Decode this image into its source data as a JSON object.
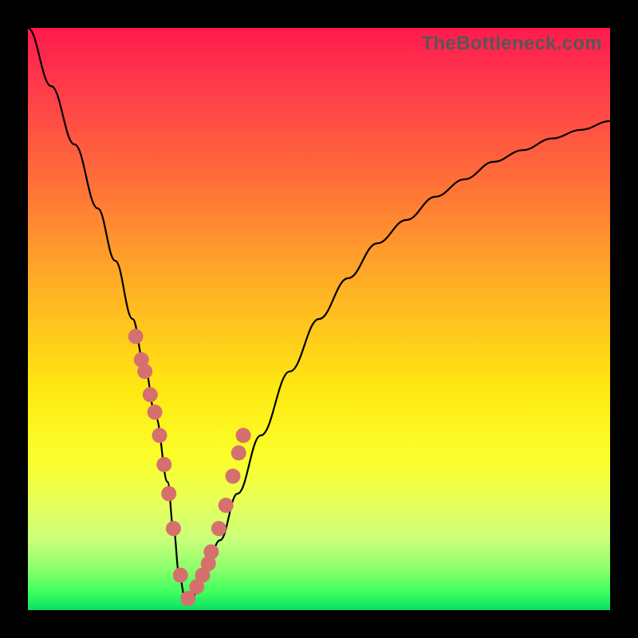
{
  "watermark": "TheBottleneck.com",
  "chart_data": {
    "type": "line",
    "title": "",
    "xlabel": "",
    "ylabel": "",
    "xlim": [
      0,
      100
    ],
    "ylim": [
      0,
      100
    ],
    "curve": {
      "name": "bottleneck-curve",
      "x": [
        0,
        4,
        8,
        12,
        15,
        18,
        20,
        22,
        24,
        25,
        26,
        27,
        28,
        30,
        33,
        36,
        40,
        45,
        50,
        55,
        60,
        65,
        70,
        75,
        80,
        85,
        90,
        95,
        100
      ],
      "y": [
        100,
        90,
        80,
        69,
        60,
        50,
        42,
        33,
        22,
        14,
        6,
        2,
        2,
        5,
        12,
        20,
        30,
        41,
        50,
        57,
        63,
        67,
        71,
        74,
        77,
        79,
        81,
        82.5,
        84
      ]
    },
    "dots": {
      "name": "highlight-points",
      "color": "#d6706f",
      "x": [
        18.5,
        19.5,
        20.1,
        21.0,
        21.8,
        22.6,
        23.4,
        24.2,
        25.0,
        26.2,
        27.5,
        29.0,
        30.0,
        31.0,
        31.5,
        32.8,
        34.0,
        35.2,
        36.2,
        37.0
      ],
      "y": [
        47,
        43,
        41,
        37,
        34,
        30,
        25,
        20,
        14,
        6,
        2,
        4,
        6,
        8,
        10,
        14,
        18,
        23,
        27,
        30
      ]
    },
    "gradient_stops": [
      {
        "pos": 0,
        "color": "#ff1a4d"
      },
      {
        "pos": 25,
        "color": "#ff6a3a"
      },
      {
        "pos": 50,
        "color": "#ffc21e"
      },
      {
        "pos": 75,
        "color": "#fbff2b"
      },
      {
        "pos": 100,
        "color": "#0adf63"
      }
    ]
  }
}
